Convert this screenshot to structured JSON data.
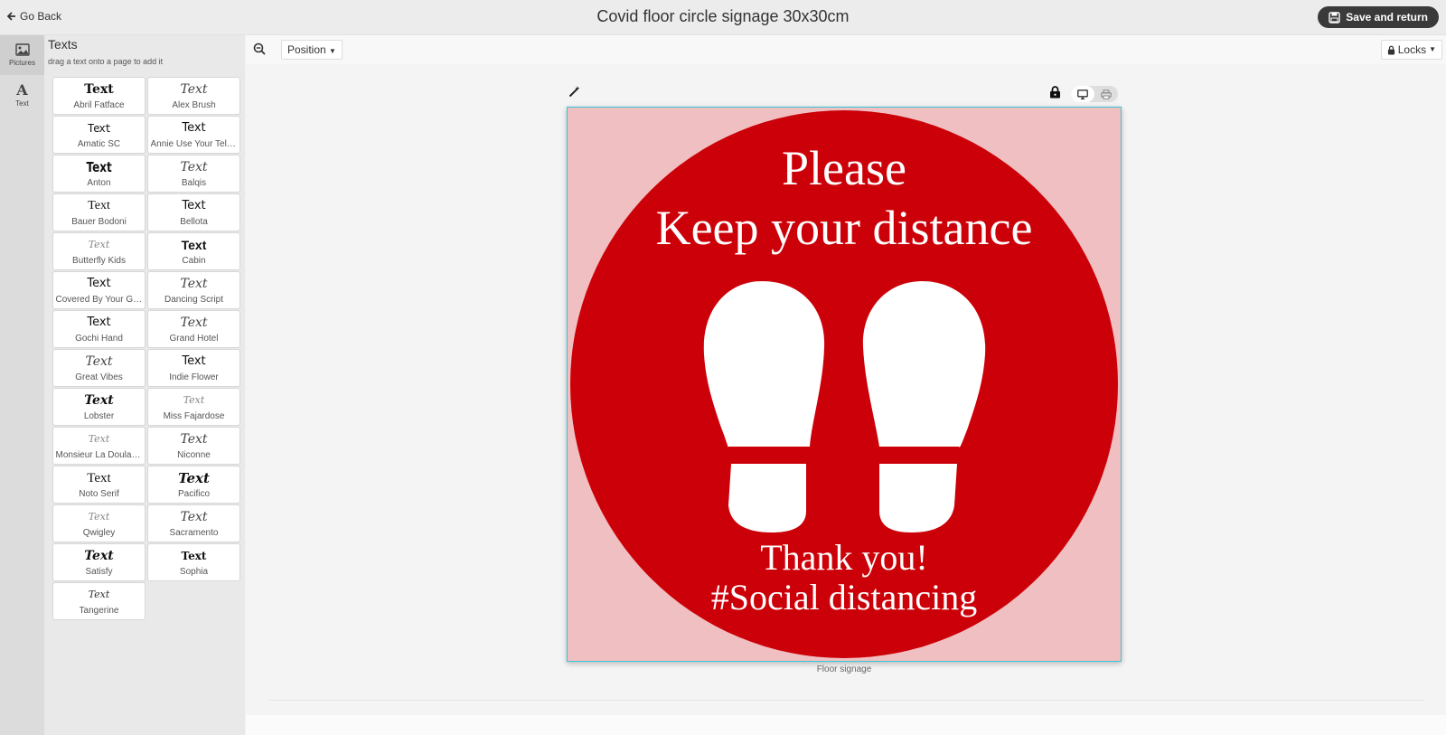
{
  "topbar": {
    "back_label": "Go Back",
    "title": "Covid floor circle signage 30x30cm",
    "save_label": "Save and return"
  },
  "rail": {
    "items": [
      {
        "label": "Pictures",
        "icon": "image-icon"
      },
      {
        "label": "Text",
        "icon": "text-icon"
      }
    ]
  },
  "panel": {
    "title": "Texts",
    "subtitle": "drag a text onto a page to add it",
    "sample": "Text",
    "fonts": [
      "Abril Fatface",
      "Alex Brush",
      "Amatic SC",
      "Annie Use Your Telescope",
      "Anton",
      "Balqis",
      "Bauer Bodoni",
      "Bellota",
      "Butterfly Kids",
      "Cabin",
      "Covered By Your Grace",
      "Dancing Script",
      "Gochi Hand",
      "Grand Hotel",
      "Great Vibes",
      "Indie Flower",
      "Lobster",
      "Miss Fajardose",
      "Monsieur La Doulaise",
      "Niconne",
      "Noto Serif",
      "Pacifico",
      "Qwigley",
      "Sacramento",
      "Satisfy",
      "Sophia",
      "Tangerine"
    ]
  },
  "toolbar": {
    "position_label": "Position",
    "locks_label": "Locks"
  },
  "canvas": {
    "caption": "Floor signage",
    "line1": "Please",
    "line2": "Keep your distance",
    "line3": "Thank you!",
    "line4": "#Social distancing",
    "colors": {
      "background": "#f0bfc1",
      "circle": "#cc0008",
      "text": "#ffffff",
      "selection": "#36c7d6"
    }
  }
}
